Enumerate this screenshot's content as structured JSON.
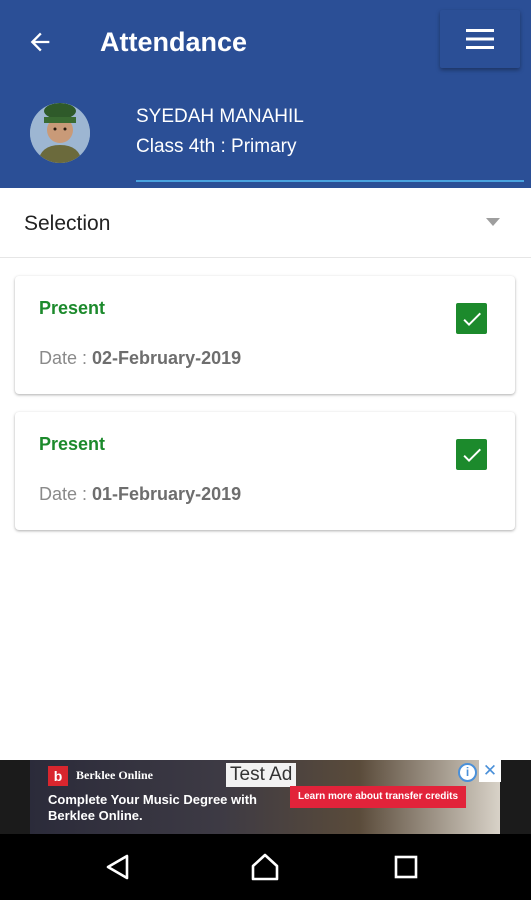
{
  "header": {
    "title": "Attendance",
    "back_icon": "arrow-left-icon",
    "menu_icon": "hamburger-menu-icon",
    "background_color": "#2b4f96"
  },
  "profile": {
    "name": "SYEDAH MANAHIL",
    "class_info": "Class 4th : Primary",
    "avatar_icon": "student-avatar"
  },
  "filter": {
    "selected": "Selection",
    "caret_icon": "dropdown-caret-icon"
  },
  "records": [
    {
      "status": "Present",
      "date_label": "Date : ",
      "date": "02-February-2019",
      "checked": true
    },
    {
      "status": "Present",
      "date_label": "Date : ",
      "date": "01-February-2019",
      "checked": true
    }
  ],
  "colors": {
    "present": "#1c8a2c",
    "accent_line": "#4aa3df"
  },
  "ad": {
    "brand": "Berklee Online",
    "tag": "Test Ad",
    "headline": "Complete Your Music Degree with Berklee Online.",
    "cta": "Learn more about transfer credits",
    "info_icon": "info-icon",
    "close_icon": "close-icon"
  },
  "system_nav": {
    "back_icon": "nav-back-icon",
    "home_icon": "nav-home-icon",
    "recents_icon": "nav-recents-icon"
  }
}
